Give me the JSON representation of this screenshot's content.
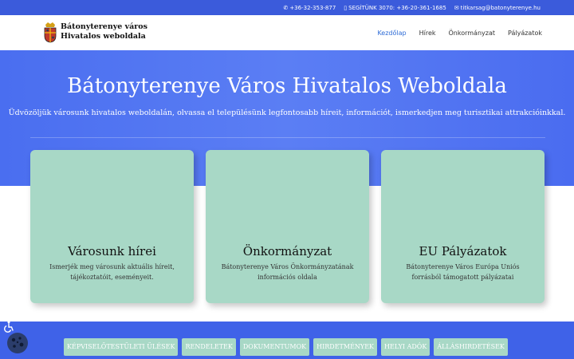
{
  "topbar": {
    "phone": "+36-32-353-877",
    "help": "SEGÍTÜNK 3070: +36-20-361-1685",
    "email": "titkarsag@batonyterenye.hu"
  },
  "header": {
    "brand_line1": "Bátonyterenye város",
    "brand_line2": "Hivatalos weboldala",
    "nav": [
      "Kezdőlap",
      "Hírek",
      "Önkormányzat",
      "Pályázatok"
    ]
  },
  "hero": {
    "title": "Bátonyterenye Város Hivatalos Weboldala",
    "subtitle": "Üdvözöljük városunk hivatalos weboldalán, olvassa el településünk legfontosabb híreit, információt, ismerkedjen meg turisztikai attrakcióinkkal."
  },
  "cards": [
    {
      "title": "Városunk hírei",
      "text": "Ismerjék meg városunk aktuális híreit, tájékoztatóit, eseményeit."
    },
    {
      "title": "Önkormányzat",
      "text": "Bátonyterenye Város Önkormányzatának információs oldala"
    },
    {
      "title": "EU Pályázatok",
      "text": "Bátonyterenye Város Európa Uniós forrásból támogatott pályázatai"
    }
  ],
  "buttons": [
    "KÉPVISELŐTESTÜLETI ÜLÉSEK",
    "RENDELETEK",
    "DOKUMENTUMOK",
    "HIRDETMÉNYEK",
    "HELYI ADÓK",
    "ÁLLÁSHIRDETÉSEK"
  ],
  "colors": {
    "accent": "#3b5bdb",
    "card": "#a8d8c6",
    "nav_active": "#2d6bd6"
  },
  "icons": [
    "phone-icon",
    "mobile-icon",
    "envelope-icon",
    "accessibility-icon",
    "cookie-icon"
  ]
}
